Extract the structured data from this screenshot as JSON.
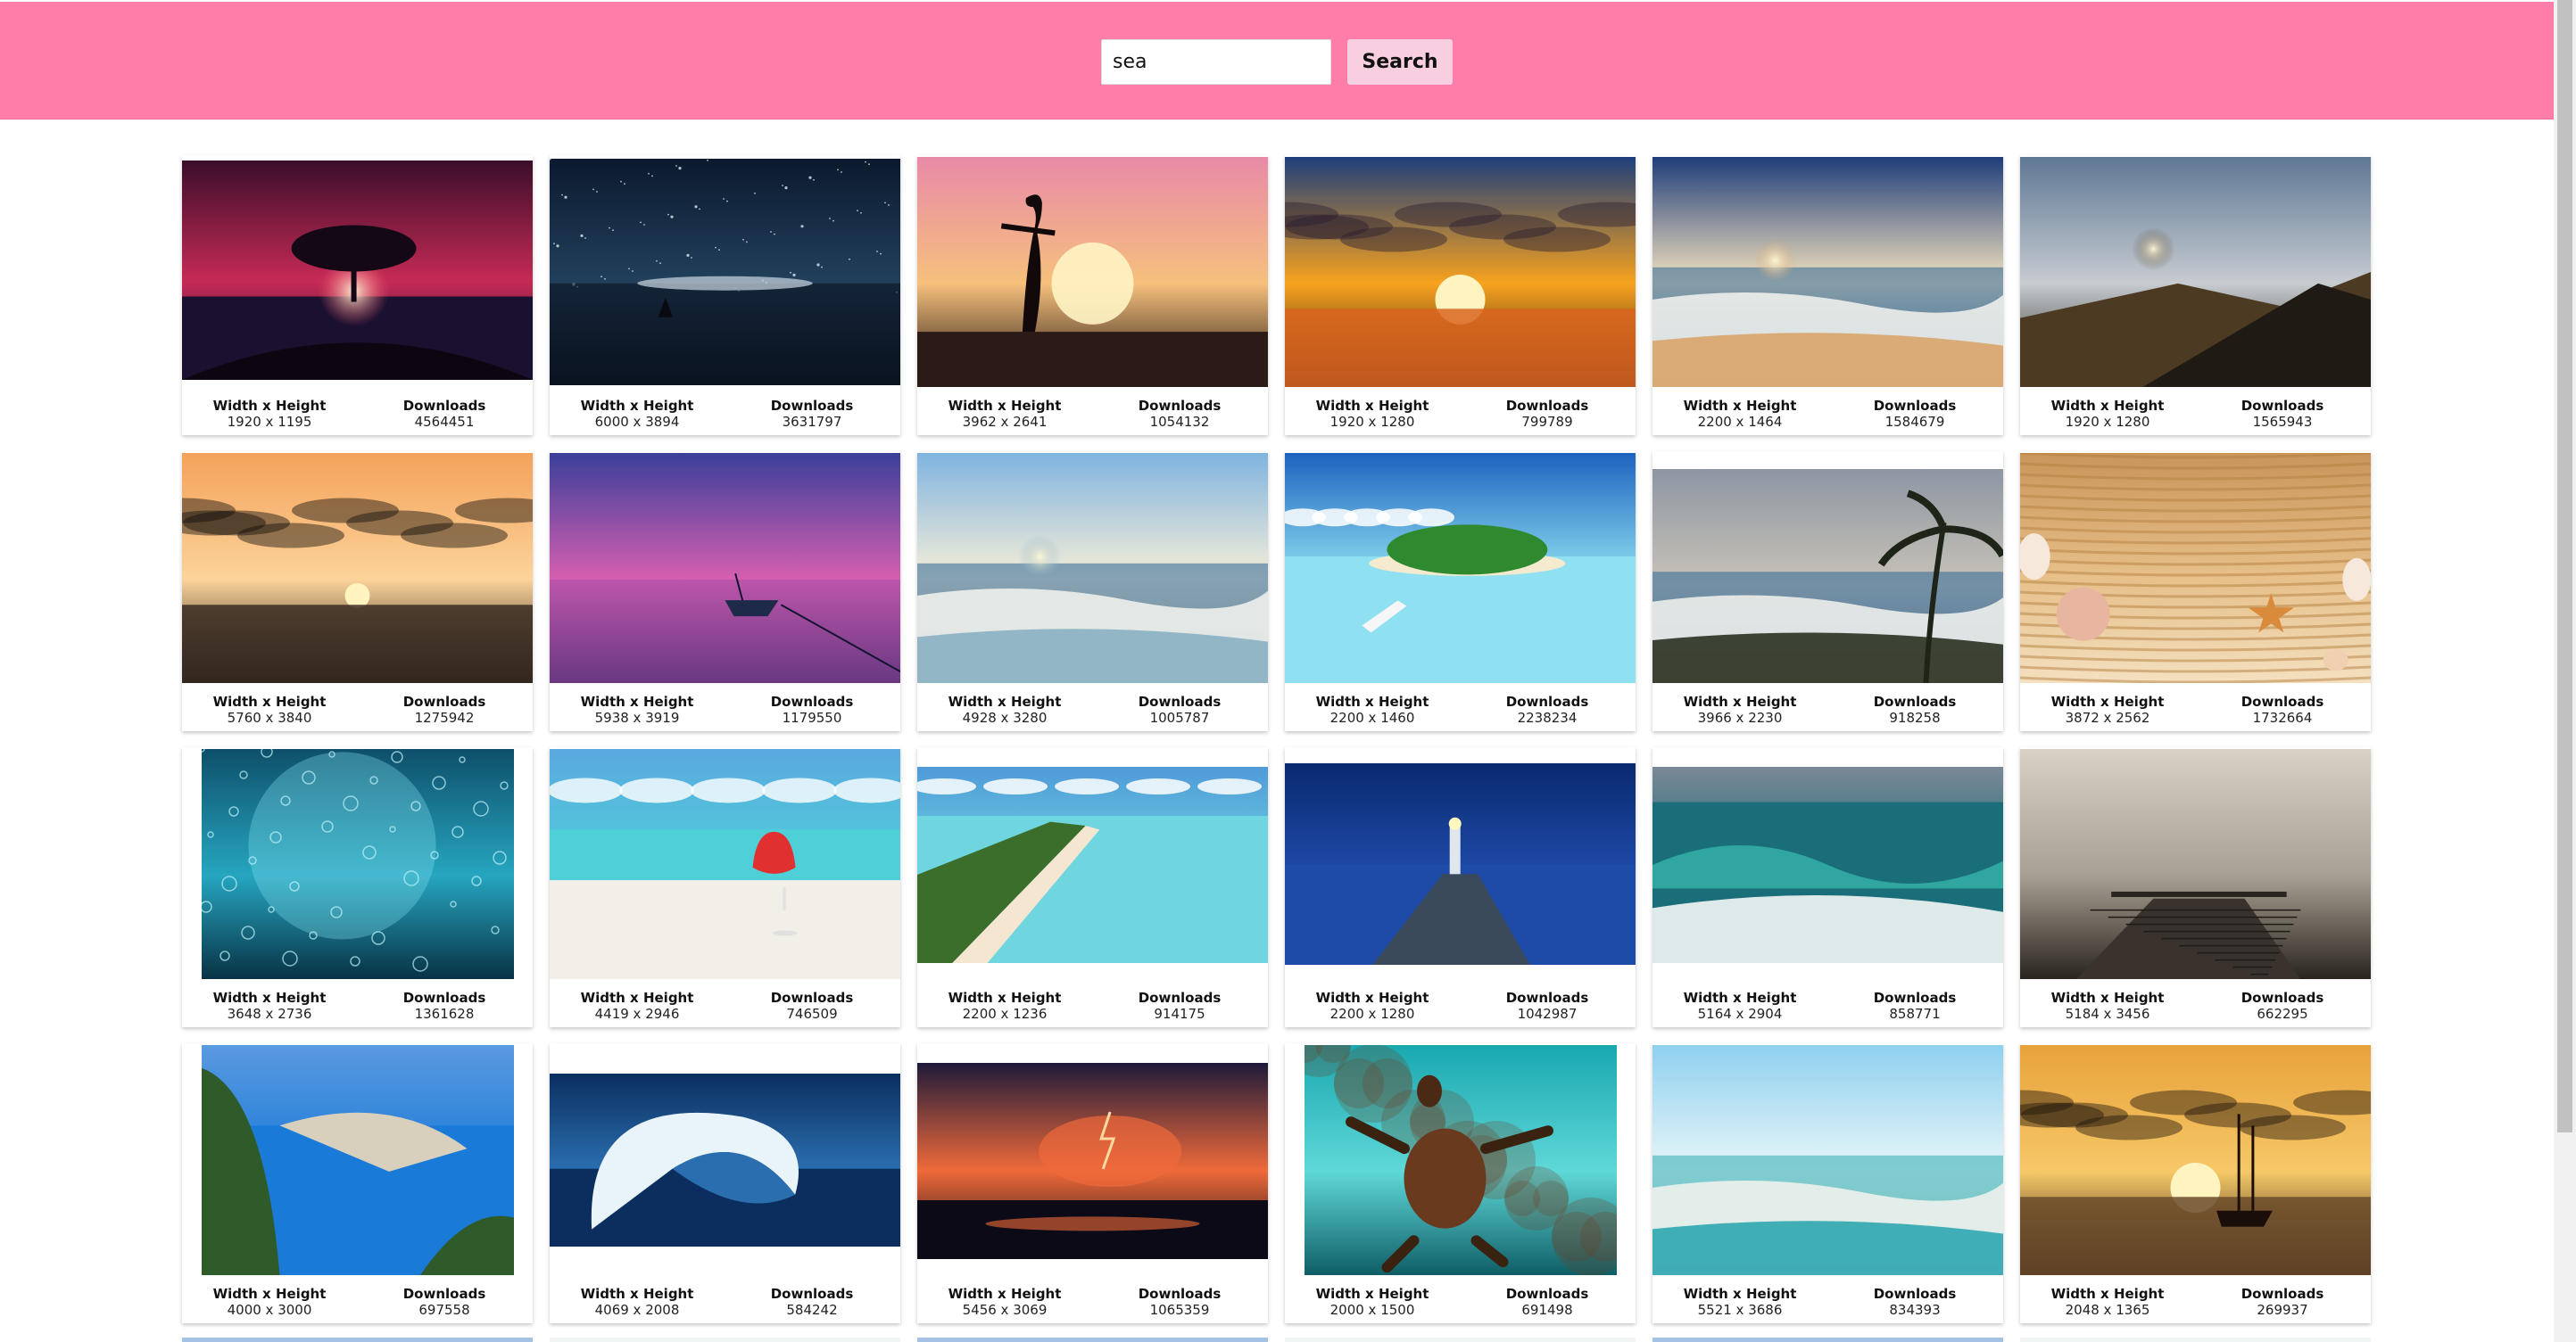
{
  "search": {
    "value": "sea",
    "button_label": "Search"
  },
  "labels": {
    "size": "Width x Height",
    "downloads": "Downloads"
  },
  "rows": [
    [
      {
        "size": "1920 x 1195",
        "downloads": "4564451",
        "scene": "tree-sunset",
        "colors": [
          "#3a0e2a",
          "#c62a55",
          "#ff5a6e",
          "#1a1030"
        ]
      },
      {
        "size": "6000 x 3894",
        "downloads": "3631797",
        "scene": "starry-sea",
        "colors": [
          "#0b1a2e",
          "#22405c",
          "#7fa0b8",
          "#0a1320"
        ]
      },
      {
        "size": "3962 x 2641",
        "downloads": "1054132",
        "scene": "silhouette-sunset",
        "colors": [
          "#e88aa8",
          "#f6c07c",
          "#fde39a",
          "#1a0f10"
        ]
      },
      {
        "size": "1920 x 1280",
        "downloads": "799789",
        "scene": "cloudy-sunset",
        "colors": [
          "#1e3e7a",
          "#f7a21e",
          "#d9641e",
          "#2a1a14"
        ]
      },
      {
        "size": "2200 x 1464",
        "downloads": "1584679",
        "scene": "beach-waves",
        "colors": [
          "#1f3d7a",
          "#f5e4c0",
          "#d9a46a",
          "#2e5b8f"
        ]
      },
      {
        "size": "1920 x 1280",
        "downloads": "1565943",
        "scene": "mountain-coast",
        "colors": [
          "#5f7894",
          "#c7ccd1",
          "#4d3a23",
          "#1f1a14"
        ]
      }
    ],
    [
      {
        "size": "5760 x 3840",
        "downloads": "1275942",
        "scene": "ocean-sunset",
        "colors": [
          "#f4a25a",
          "#fcd39a",
          "#3a2b22",
          "#0f0d0b"
        ]
      },
      {
        "size": "5938 x 3919",
        "downloads": "1179550",
        "scene": "purple-lake-boat",
        "colors": [
          "#3a3f9a",
          "#d65fb0",
          "#f08ac8",
          "#1c1e52"
        ]
      },
      {
        "size": "4928 x 3280",
        "downloads": "1005787",
        "scene": "bright-beach",
        "colors": [
          "#7fb4e0",
          "#f6eed8",
          "#8ab0c2",
          "#c9c0a0"
        ]
      },
      {
        "size": "2200 x 1460",
        "downloads": "2238234",
        "scene": "tropical-island",
        "colors": [
          "#1e62c0",
          "#8fe0f0",
          "#2f8a2f",
          "#5fd0e8"
        ]
      },
      {
        "size": "3966 x 2230",
        "downloads": "918258",
        "scene": "palm-beach",
        "colors": [
          "#8d96a3",
          "#c9c3b8",
          "#2a3020",
          "#6f7c87"
        ]
      },
      {
        "size": "3872 x 2562",
        "downloads": "1732664",
        "scene": "sand-shells",
        "colors": [
          "#c9955a",
          "#e7c08a",
          "#b4803f",
          "#f4e0c0"
        ]
      }
    ],
    [
      {
        "size": "3648 x 2736",
        "downloads": "1361628",
        "scene": "underwater-bubbles",
        "colors": [
          "#0e4f6a",
          "#26a6c0",
          "#7fe0ef",
          "#083244"
        ]
      },
      {
        "size": "4419 x 2946",
        "downloads": "746509",
        "scene": "cocktail-beach",
        "colors": [
          "#5aa9e0",
          "#4fd0d8",
          "#f1efe8",
          "#e03030"
        ]
      },
      {
        "size": "2200 x 1236",
        "downloads": "914175",
        "scene": "aerial-beach",
        "colors": [
          "#4f9ad8",
          "#6fd6e0",
          "#f5e6d2",
          "#3a6e2a"
        ]
      },
      {
        "size": "2200 x 1280",
        "downloads": "1042987",
        "scene": "lighthouse",
        "colors": [
          "#0a2a70",
          "#1e4aa8",
          "#3a4a5a",
          "#0d1a36"
        ]
      },
      {
        "size": "5164 x 2904",
        "downloads": "858771",
        "scene": "big-waves",
        "colors": [
          "#7a8896",
          "#1a6e7a",
          "#2fa6a0",
          "#f4f6f6"
        ]
      },
      {
        "size": "5184 x 3456",
        "downloads": "662295",
        "scene": "foggy-pier",
        "colors": [
          "#d8d2c4",
          "#a8a092",
          "#5a5048",
          "#2a2420"
        ]
      }
    ],
    [
      {
        "size": "4000 x 3000",
        "downloads": "697558",
        "scene": "navagio-bay",
        "colors": [
          "#5a9ae0",
          "#1a7ad8",
          "#d8d0bc",
          "#2f5a2a"
        ]
      },
      {
        "size": "4069 x 2008",
        "downloads": "584242",
        "scene": "barrel-wave",
        "colors": [
          "#0b2e5e",
          "#2a6eb0",
          "#e8f4fa",
          "#1a4a80"
        ]
      },
      {
        "size": "5456 x 3069",
        "downloads": "1065359",
        "scene": "lightning-sea",
        "colors": [
          "#1e1a3a",
          "#f06a3a",
          "#5a3a5a",
          "#0b0a16"
        ]
      },
      {
        "size": "2000 x 1500",
        "downloads": "691498",
        "scene": "turtle",
        "colors": [
          "#19a8b0",
          "#5fd8d8",
          "#6a3a1e",
          "#0f5e66"
        ]
      },
      {
        "size": "5521 x 3686",
        "downloads": "834393",
        "scene": "wave-splash",
        "colors": [
          "#8fd0ef",
          "#e8f6f8",
          "#2fa6b0",
          "#d8d0b8"
        ]
      },
      {
        "size": "2048 x 1365",
        "downloads": "269937",
        "scene": "ship-sunset",
        "colors": [
          "#e8a23a",
          "#f6c868",
          "#6a4a2a",
          "#20140c"
        ]
      }
    ]
  ]
}
